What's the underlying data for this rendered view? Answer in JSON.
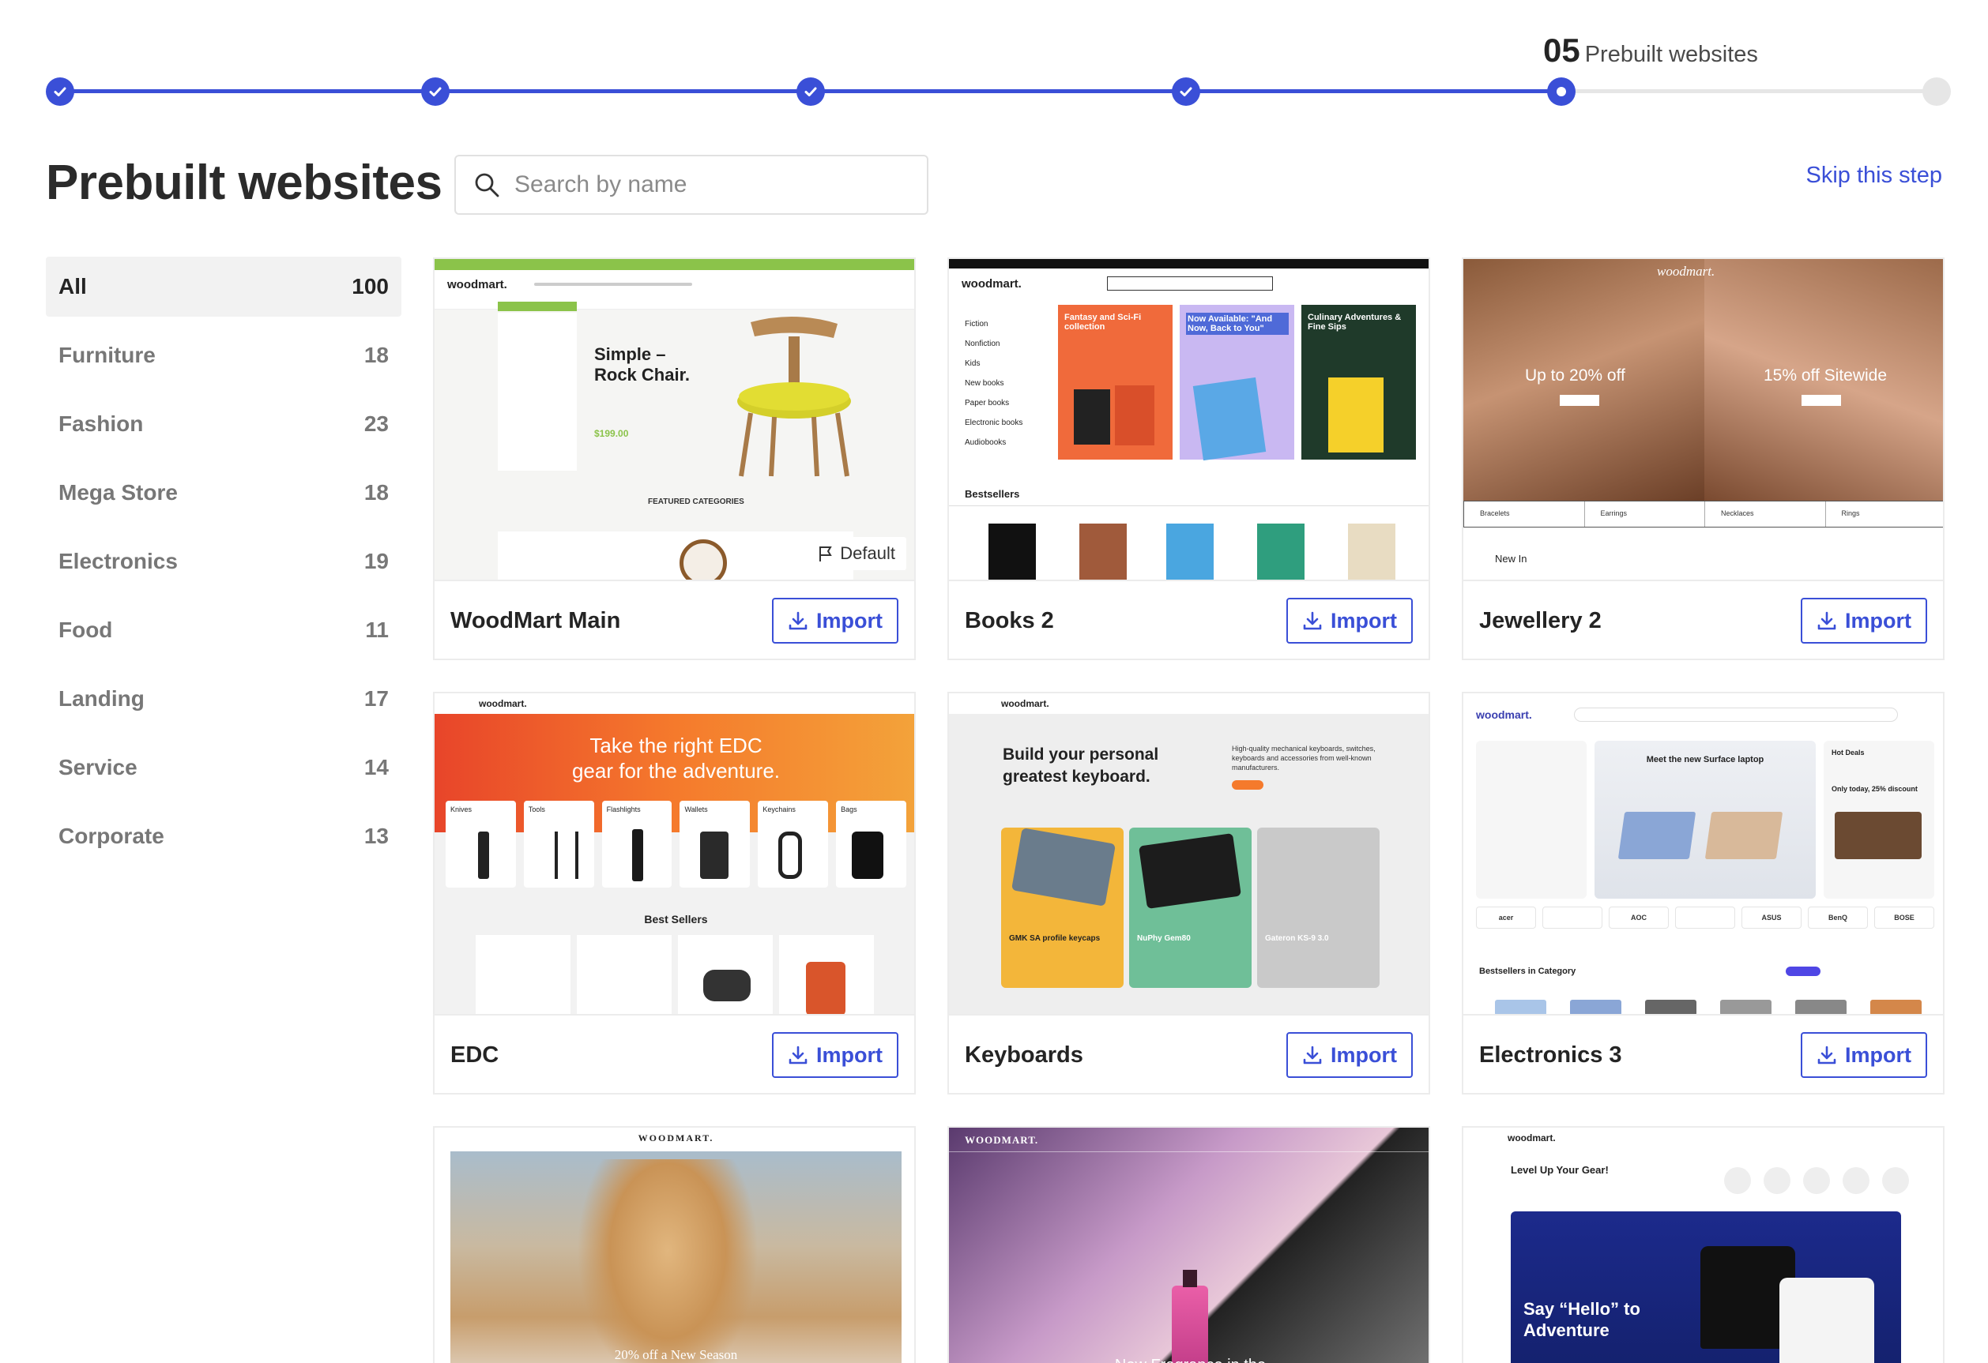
{
  "stepper": {
    "current_number": "05",
    "current_label": "Prebuilt websites",
    "steps_completed": 4,
    "steps_total": 6
  },
  "header": {
    "title": "Prebuilt websites",
    "search_placeholder": "Search by name",
    "skip_label": "Skip this step"
  },
  "categories": [
    {
      "label": "All",
      "count": "100",
      "active": true
    },
    {
      "label": "Furniture",
      "count": "18"
    },
    {
      "label": "Fashion",
      "count": "23"
    },
    {
      "label": "Mega Store",
      "count": "18"
    },
    {
      "label": "Electronics",
      "count": "19"
    },
    {
      "label": "Food",
      "count": "11"
    },
    {
      "label": "Landing",
      "count": "17"
    },
    {
      "label": "Service",
      "count": "14"
    },
    {
      "label": "Corporate",
      "count": "13"
    }
  ],
  "import_label": "Import",
  "default_badge": "Default",
  "sites": [
    {
      "name": "WoodMart Main"
    },
    {
      "name": "Books 2"
    },
    {
      "name": "Jewellery 2"
    },
    {
      "name": "EDC"
    },
    {
      "name": "Keyboards"
    },
    {
      "name": "Electronics 3"
    }
  ],
  "thumbs": {
    "woodmart_main": {
      "logo": "woodmart.",
      "hero_title": "Simple –\nRock Chair.",
      "price": "$199.00",
      "section": "FEATURED CATEGORIES"
    },
    "books": {
      "logo": "woodmart.",
      "side_items": [
        "Fiction",
        "Nonfiction",
        "Kids",
        "New books",
        "Paper books",
        "Electronic books",
        "Audiobooks"
      ],
      "banner1": "Fantasy and Sci-Fi collection",
      "banner2": "Now Available: \"And Now, Back to You\"",
      "banner3": "Culinary Adventures & Fine Sips",
      "bestsellers": "Bestsellers"
    },
    "jewellery": {
      "logo": "woodmart.",
      "left_promo": "Up to 20% off",
      "right_promo": "15% off Sitewide",
      "tabs": [
        "Bracelets",
        "Earrings",
        "Necklaces",
        "Rings"
      ],
      "new_in": "New In"
    },
    "edc": {
      "logo": "woodmart.",
      "hero": "Take the right EDC\ngear for the adventure.",
      "cats": [
        "Knives",
        "Tools",
        "Flashlights",
        "Wallets",
        "Keychains",
        "Bags"
      ],
      "best_sellers": "Best Sellers"
    },
    "keyboards": {
      "logo": "woodmart.",
      "hero": "Build your personal\ngreatest keyboard.",
      "sub": "High-quality mechanical keyboards, switches, keyboards and accessories from well-known manufacturers.",
      "tiles": [
        "GMK SA profile keycaps",
        "NuPhy Gem80",
        "Gateron KS-9 3.0"
      ]
    },
    "electronics": {
      "logo": "woodmart.",
      "hero": "Meet the new Surface laptop",
      "hot": "Hot Deals",
      "deal": "Only today, 25% discount",
      "brands": [
        "acer",
        "",
        "AOC",
        "",
        "ASUS",
        "BenQ",
        "BOSE"
      ],
      "bestsellers": "Bestsellers in Category"
    },
    "fashion": {
      "logo": "WOODMART.",
      "promo": "20% off a New Season"
    },
    "fragrance": {
      "logo": "WOODMART.",
      "promo": "New Fragrance in the"
    },
    "merch": {
      "logo": "woodmart.",
      "tag": "Level Up Your Gear!",
      "hero": "Say “Hello” to\nAdventure"
    }
  },
  "colors": {
    "accent": "#3a4fd7",
    "text": "#242424",
    "muted": "#777777"
  }
}
